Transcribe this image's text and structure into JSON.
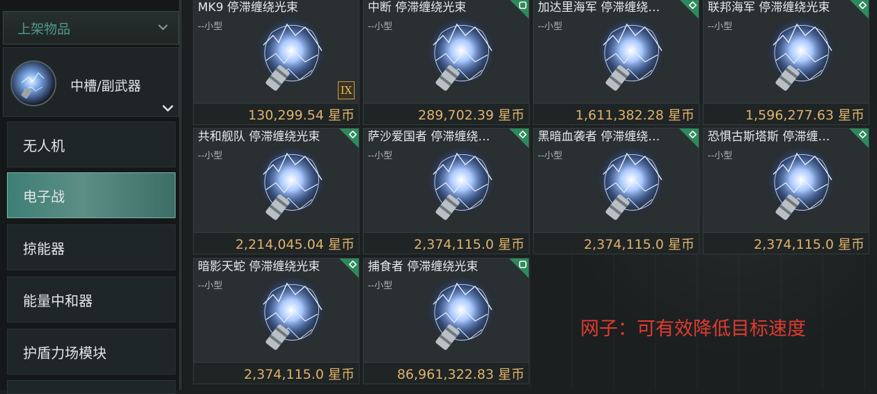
{
  "sidebar": {
    "dropdown_label": "上架物品",
    "category": {
      "label": "中槽/副武器",
      "icon": "stasis-webifier-icon"
    },
    "items": [
      {
        "label": "无人机",
        "active": false
      },
      {
        "label": "电子战",
        "active": true
      },
      {
        "label": "掠能器",
        "active": false
      },
      {
        "label": "能量中和器",
        "active": false
      },
      {
        "label": "护盾力场模块",
        "active": false
      }
    ]
  },
  "cards": [
    {
      "title": "MK9 停滞缠绕光束",
      "size": "--小型",
      "price": "130,299.54 星币",
      "badge": "none",
      "tech": "IX"
    },
    {
      "title": "中断 停滞缠绕光束",
      "size": "--小型",
      "price": "289,702.39 星币",
      "badge": "square",
      "tech": ""
    },
    {
      "title": "加达里海军 停滞缠绕…",
      "size": "--小型",
      "price": "1,611,382.28 星币",
      "badge": "diamond",
      "tech": ""
    },
    {
      "title": "联邦海军 停滞缠绕光束",
      "size": "--小型",
      "price": "1,596,277.63 星币",
      "badge": "diamond",
      "tech": ""
    },
    {
      "title": "共和舰队 停滞缠绕光束",
      "size": "--小型",
      "price": "2,214,045.04 星币",
      "badge": "diamond",
      "tech": ""
    },
    {
      "title": "萨沙爱国者 停滞缠绕…",
      "size": "--小型",
      "price": "2,374,115.0 星币",
      "badge": "diamond",
      "tech": ""
    },
    {
      "title": "黑暗血袭者 停滞缠绕…",
      "size": "--小型",
      "price": "2,374,115.0 星币",
      "badge": "diamond",
      "tech": ""
    },
    {
      "title": "恐惧古斯塔斯 停滞缠…",
      "size": "--小型",
      "price": "2,374,115.0 星币",
      "badge": "diamond",
      "tech": ""
    },
    {
      "title": "暗影天蛇 停滞缠绕光束",
      "size": "--小型",
      "price": "2,374,115.0 星币",
      "badge": "diamond",
      "tech": ""
    },
    {
      "title": "捕食者 停滞缠绕光束",
      "size": "--小型",
      "price": "86,961,322.83 星币",
      "badge": "square",
      "tech": ""
    }
  ],
  "annotation": "网子：可有效降低目标速度",
  "colors": {
    "accent": "#2e8a5c",
    "price": "#e0b36a",
    "annotation": "#e23a2f",
    "active_tab": "#4e8a80"
  }
}
